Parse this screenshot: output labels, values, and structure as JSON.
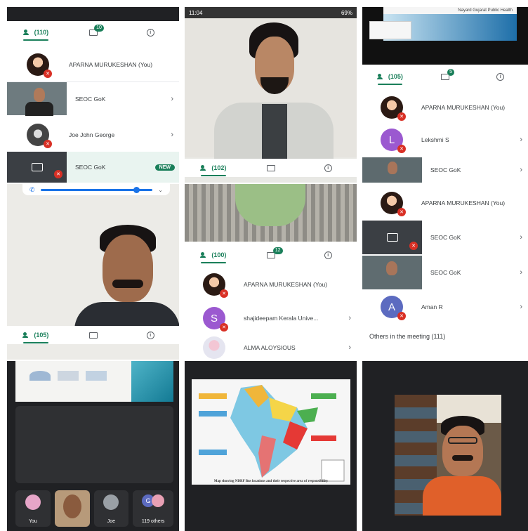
{
  "p1": {
    "tabs": {
      "people_count": "(110)",
      "chat_badge": "10"
    },
    "rows": [
      {
        "name": "APARNA MURUKESHAN (You)"
      },
      {
        "name": "SEOC GoK"
      },
      {
        "name": "Joe John George"
      },
      {
        "name": "SEOC GoK",
        "badge": "NEW"
      }
    ]
  },
  "p2": {
    "status_time": "11:04",
    "status_battery": "69%"
  },
  "p3": {
    "banner_text": "Nayard Gujarat Public Health",
    "tabs": {
      "people_count": "(105)",
      "chat_badge": "5"
    },
    "rows": [
      {
        "name": "APARNA MURUKESHAN (You)"
      },
      {
        "name": "Lekshmi S",
        "initial": "L"
      },
      {
        "name": "SEOC GoK"
      }
    ]
  },
  "p4": {
    "tabs": {
      "people_count": "(105)"
    }
  },
  "p5": {
    "tabs": {
      "people_count": "(102)"
    },
    "tabs2": {
      "people_count": "(100)",
      "chat_badge": "12"
    },
    "rows": [
      {
        "name": "APARNA MURUKESHAN (You)"
      },
      {
        "name": "shajideepam Kerala Unive...",
        "initial": "S"
      },
      {
        "name": "ALMA ALOYSIOUS"
      }
    ]
  },
  "p6": {
    "rows": [
      {
        "name": "APARNA MURUKESHAN (You)"
      },
      {
        "name": "SEOC GoK"
      },
      {
        "name": "SEOC GoK"
      },
      {
        "name": "Aman R",
        "initial": "A"
      }
    ],
    "others_text": "Others in the meeting (111)"
  },
  "p7": {
    "participants": [
      {
        "label": "You"
      },
      {
        "label": ""
      },
      {
        "label": "Joe"
      },
      {
        "label": "119 others",
        "initial": "G"
      }
    ]
  },
  "p8": {
    "caption": "Map showing NDRF Bns locations and their respective area of responsibility"
  },
  "colors": {
    "accent": "#1a7f5a",
    "mute": "#d93025",
    "avatar_purple": "#9b59d0",
    "avatar_indigo": "#5c6bc0"
  }
}
